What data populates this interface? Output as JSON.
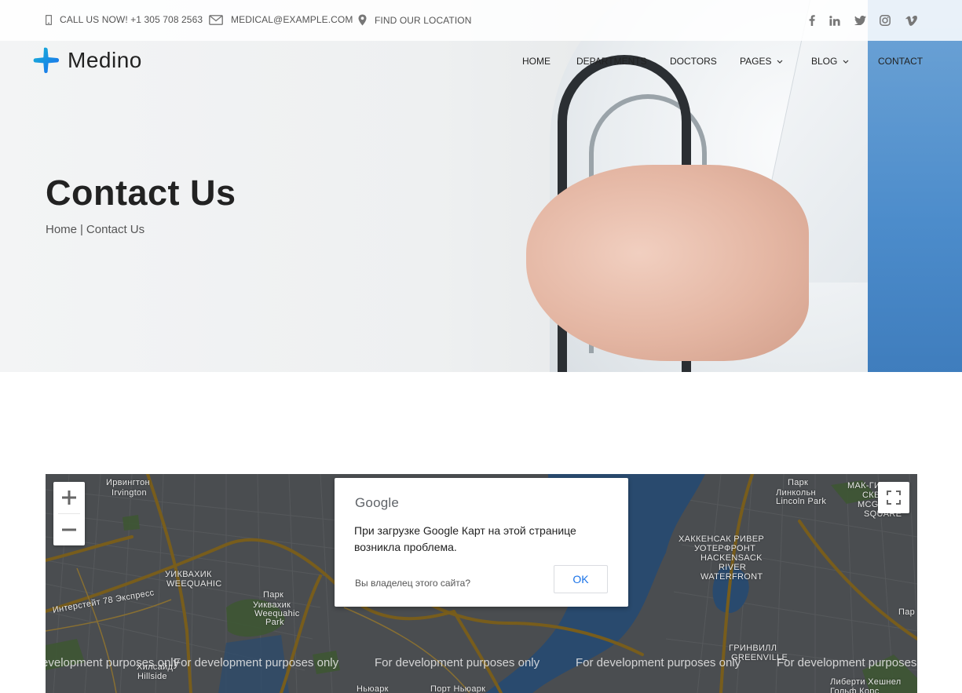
{
  "topbar": {
    "phone": "CALL US NOW! +1 305 708 2563",
    "email": "MEDICAL@EXAMPLE.COM",
    "location": "FIND OUR LOCATION",
    "social": [
      {
        "name": "facebook-icon",
        "glyph": "f"
      },
      {
        "name": "linkedin-icon",
        "glyph": "in"
      },
      {
        "name": "twitter-icon",
        "glyph": "t"
      },
      {
        "name": "instagram-icon",
        "glyph": "ig"
      },
      {
        "name": "vimeo-icon",
        "glyph": "v"
      }
    ]
  },
  "brand": {
    "name": "Medino",
    "color_primary": "#1a6cf0",
    "color_secondary": "#18b6d4"
  },
  "nav": {
    "items": [
      {
        "label": "HOME",
        "dropdown": false
      },
      {
        "label": "DEPARTMENTS",
        "dropdown": false
      },
      {
        "label": "DOCTORS",
        "dropdown": false
      },
      {
        "label": "PAGES",
        "dropdown": true
      },
      {
        "label": "BLOG",
        "dropdown": true
      },
      {
        "label": "CONTACT",
        "dropdown": false
      }
    ]
  },
  "hero": {
    "title": "Contact Us",
    "breadcrumb_home": "Home",
    "breadcrumb_sep": "|",
    "breadcrumb_current": "Contact Us"
  },
  "map": {
    "labels": [
      {
        "text": "Ирвингтон"
      },
      {
        "text": "Irvington"
      },
      {
        "text": "УИКВАХИК"
      },
      {
        "text": "WEEQUAHIC"
      },
      {
        "text": "Парк"
      },
      {
        "text": "Уиквахик"
      },
      {
        "text": "Weequahic"
      },
      {
        "text": "Park"
      },
      {
        "text": "Интерстейт 78 Экспресс"
      },
      {
        "text": "Хилсайд"
      },
      {
        "text": "Hillside"
      },
      {
        "text": "Ньюарк"
      },
      {
        "text": "Порт Ньюарк"
      },
      {
        "text": "Парк"
      },
      {
        "text": "Линкольн"
      },
      {
        "text": "Lincoln Park"
      },
      {
        "text": "МАК-ГИН"
      },
      {
        "text": "СКВЕР"
      },
      {
        "text": "MCGINLEY"
      },
      {
        "text": "SQUARE"
      },
      {
        "text": "ХАККЕНСАК РИВЕР"
      },
      {
        "text": "УОТЕРФРОНТ"
      },
      {
        "text": "HACKENSACK"
      },
      {
        "text": "RIVER"
      },
      {
        "text": "WATERFRONT"
      },
      {
        "text": "ГРИНВИЛЛ"
      },
      {
        "text": "GREENVILLE"
      },
      {
        "text": "Либерти Хешнел"
      },
      {
        "text": "Гольф Корс"
      },
      {
        "text": "Пар"
      }
    ],
    "dev_text": "For development purposes only",
    "zoom_in": "+",
    "zoom_out": "−"
  },
  "map_dialog": {
    "brand": "Google",
    "message": "При загрузке Google Карт на этой странице возникла проблема.",
    "owner_question": "Вы владелец этого сайта?",
    "ok_label": "OK"
  }
}
